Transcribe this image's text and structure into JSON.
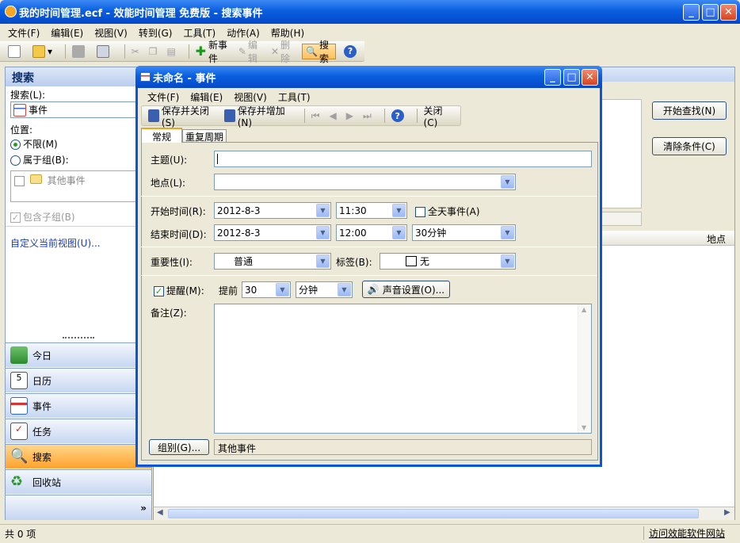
{
  "window": {
    "title": "我的时间管理.ecf - 效能时间管理 免费版 - 搜索事件"
  },
  "menu": [
    "文件(F)",
    "编辑(E)",
    "视图(V)",
    "转到(G)",
    "工具(T)",
    "动作(A)",
    "帮助(H)"
  ],
  "toolbar": {
    "new_event": "新事件",
    "edit": "编辑",
    "delete": "删除",
    "search": "搜索"
  },
  "left": {
    "header": "搜索",
    "search_label": "搜索(L):",
    "search_value": "事件",
    "location_label": "位置:",
    "opt_unlimited": "不限(M)",
    "opt_group": "属于组(B):",
    "group_item": "其他事件",
    "include_sub": "包含子组(B)",
    "custom_view": "自定义当前视图(U)...",
    "nav": [
      "今日",
      "日历",
      "事件",
      "任务",
      "搜索",
      "回收站"
    ]
  },
  "right": {
    "start_search": "开始查找(N)",
    "clear": "清除条件(C)",
    "col_location": "地点"
  },
  "status": {
    "count": "共 0 项",
    "link": "访问效能软件网站"
  },
  "dialog": {
    "title": "未命名 - 事件",
    "menu": [
      "文件(F)",
      "编辑(E)",
      "视图(V)",
      "工具(T)"
    ],
    "save_close": "保存并关闭(S)",
    "save_add": "保存并增加(N)",
    "close": "关闭(C)",
    "tabs": [
      "常规",
      "重复周期"
    ],
    "subject_label": "主题(U):",
    "subject_value": "",
    "location_label": "地点(L):",
    "start_label": "开始时间(R):",
    "start_date": "2012-8-3",
    "start_time": "11:30",
    "allday": "全天事件(A)",
    "end_label": "结束时间(D):",
    "end_date": "2012-8-3",
    "end_time": "12:00",
    "duration": "30分钟",
    "importance_label": "重要性(I):",
    "importance": "普通",
    "tag_label": "标签(B):",
    "tag": "无",
    "reminder": "提醒(M):",
    "advance": "提前",
    "advance_value": "30",
    "unit": "分钟",
    "sound": "声音设置(O)...",
    "notes_label": "备注(Z):",
    "group_btn": "组别(G)...",
    "group_value": "其他事件"
  }
}
